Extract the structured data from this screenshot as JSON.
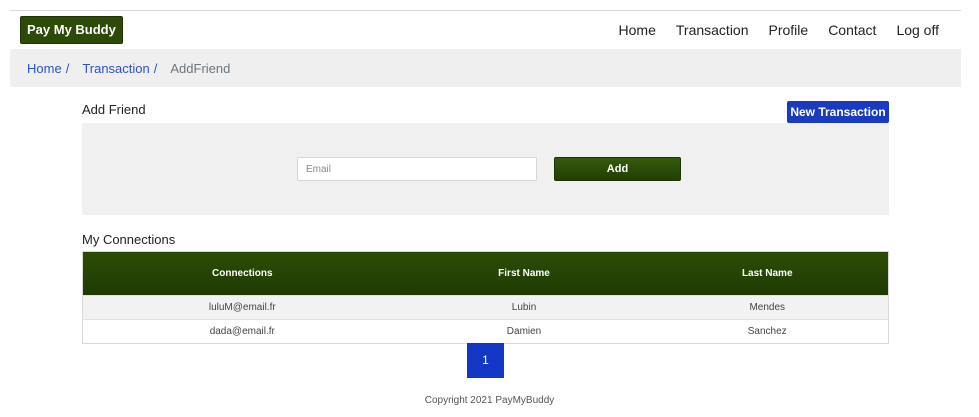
{
  "brand": "Pay My Buddy",
  "nav": {
    "home": "Home",
    "transaction": "Transaction",
    "profile": "Profile",
    "contact": "Contact",
    "logoff": "Log off"
  },
  "breadcrumb": {
    "home": "Home",
    "transaction": "Transaction",
    "separator": "/",
    "current": "AddFriend"
  },
  "add_friend": {
    "title": "Add Friend",
    "new_transaction_label": "New Transaction",
    "email_placeholder": "Email",
    "email_value": "",
    "add_label": "Add"
  },
  "connections": {
    "title": "My Connections",
    "columns": [
      "Connections",
      "First Name",
      "Last Name"
    ],
    "rows": [
      [
        "luluM@email.fr",
        "Lubin",
        "Mendes"
      ],
      [
        "dada@email.fr",
        "Damien",
        "Sanchez"
      ]
    ]
  },
  "pagination": {
    "current_page": "1"
  },
  "footer": "Copyright 2021 PayMyBuddy",
  "colors": {
    "brand_green": "#2d4a08",
    "accent_blue": "#1a3bc0",
    "link_blue": "#2a52c9"
  }
}
